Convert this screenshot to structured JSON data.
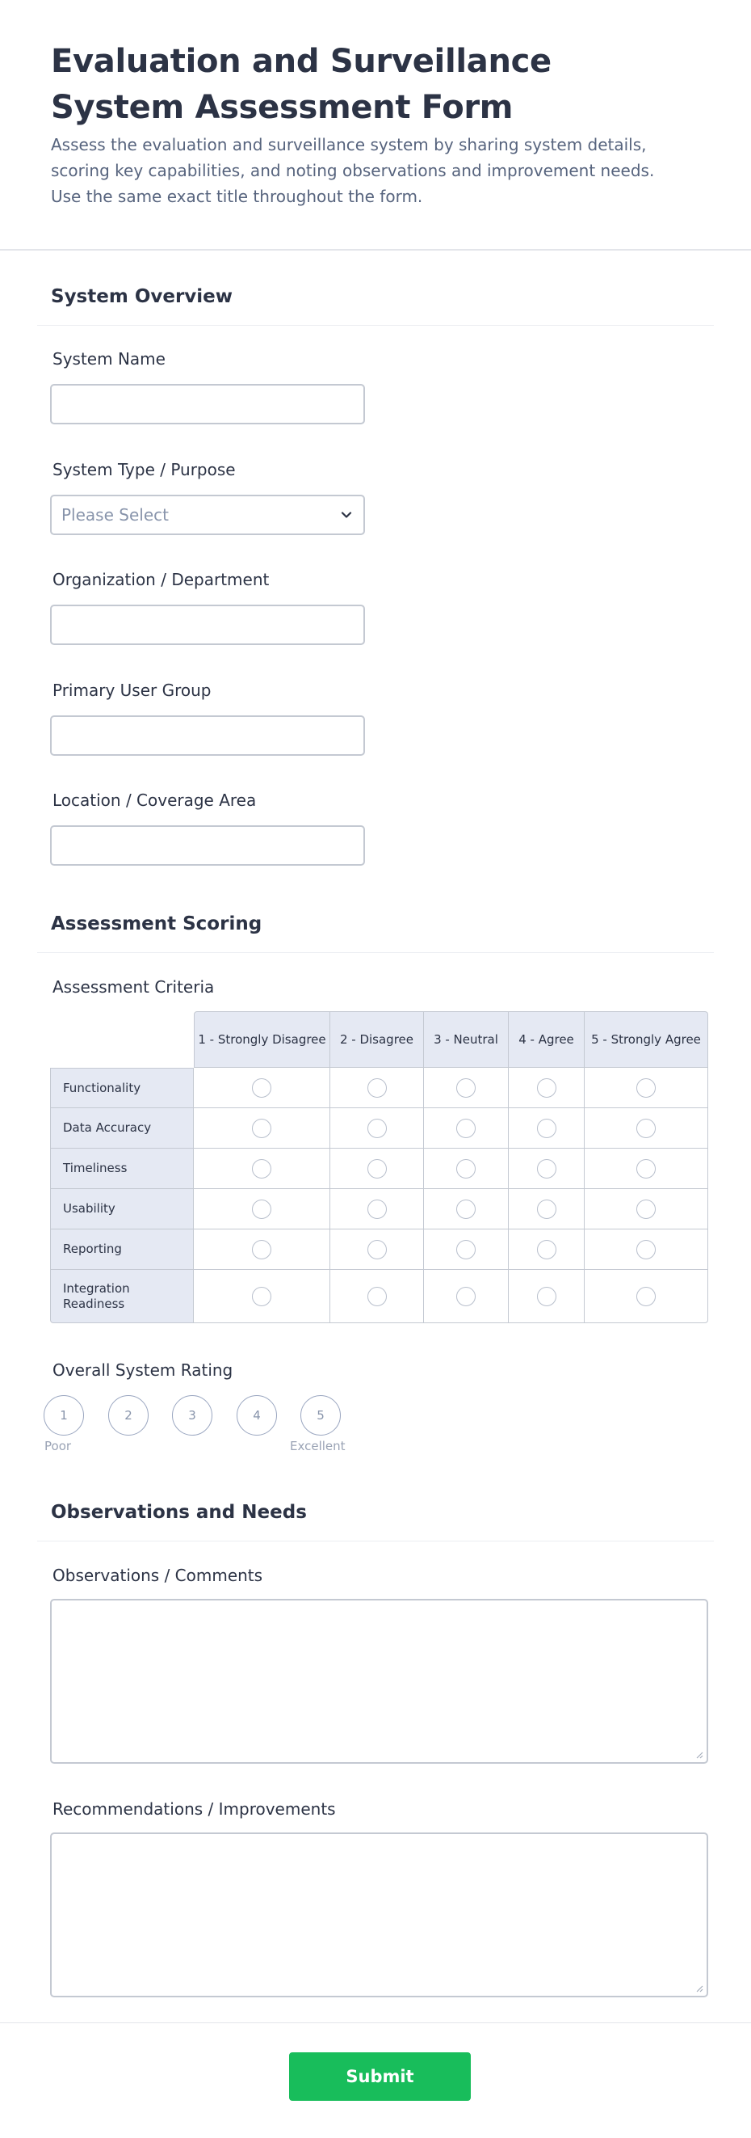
{
  "form": {
    "title": "Evaluation and Surveillance System Assessment Form",
    "description": "Assess the evaluation and surveillance system by sharing system details, scoring key capabilities, and noting observations and improvement needs. Use the same exact title throughout the form."
  },
  "sections": {
    "overview": "System Overview",
    "scoring": "Assessment Scoring",
    "observations": "Observations and Needs"
  },
  "fields": {
    "system_name": {
      "label": "System Name",
      "value": ""
    },
    "system_type": {
      "label": "System Type / Purpose",
      "placeholder": "Please Select"
    },
    "organization": {
      "label": "Organization / Department",
      "value": ""
    },
    "user_group": {
      "label": "Primary User Group",
      "value": ""
    },
    "location": {
      "label": "Location / Coverage Area",
      "value": ""
    }
  },
  "matrix": {
    "label": "Assessment Criteria",
    "columns": [
      "1 - Strongly Disagree",
      "2 - Disagree",
      "3 - Neutral",
      "4 - Agree",
      "5 - Strongly Agree"
    ],
    "rows": [
      "Functionality",
      "Data Accuracy",
      "Timeliness",
      "Usability",
      "Reporting",
      "Integration Readiness"
    ]
  },
  "rating": {
    "label": "Overall System Rating",
    "options": [
      "1",
      "2",
      "3",
      "4",
      "5"
    ],
    "min_caption": "Poor",
    "max_caption": "Excellent"
  },
  "textareas": {
    "observations": {
      "label": "Observations / Comments",
      "value": ""
    },
    "recommendations": {
      "label": "Recommendations / Improvements",
      "value": ""
    }
  },
  "submit_label": "Submit",
  "colors": {
    "accent": "#18bd5b",
    "text": "#2c3345",
    "muted": "#57647e",
    "matrix_header": "#e5e9f3"
  }
}
